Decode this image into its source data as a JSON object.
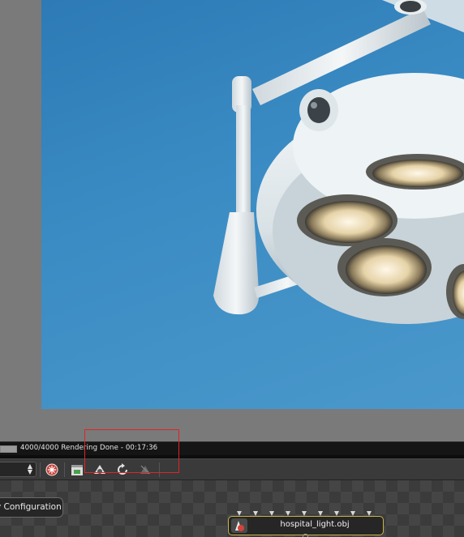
{
  "status": {
    "progress": 1.0,
    "text": "4000/4000 Rendering Done - 00:17:36"
  },
  "node_editor": {
    "configuration_button_label": "v Configuration",
    "node": {
      "label": "hospital_light.obj",
      "icon": "geometry-node-icon"
    }
  },
  "toolbar": {
    "icons": [
      "render-settings-icon",
      "clapperboard-icon",
      "camera-view-icon",
      "refresh-render-icon",
      "disabled-render-icon"
    ]
  },
  "colors": {
    "highlight": "#e02424",
    "node_border": "#c9b34a",
    "sky": "#3b8cc4"
  }
}
